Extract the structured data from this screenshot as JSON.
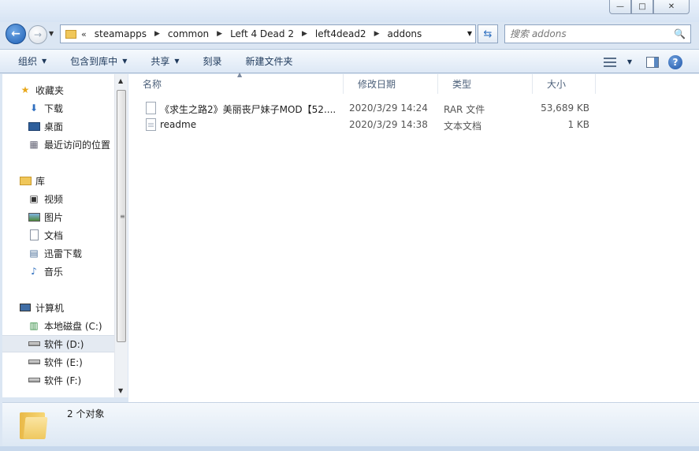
{
  "window": {
    "min_glyph": "—",
    "max_glyph": "□",
    "close_glyph": "✕"
  },
  "nav": {
    "back_glyph": "←",
    "forward_glyph": "→",
    "breadcrumb_overflow": "«",
    "breadcrumbs": [
      "steamapps",
      "common",
      "Left 4 Dead 2",
      "left4dead2",
      "addons"
    ],
    "search_placeholder": "搜索 addons"
  },
  "toolbar": {
    "organize": "组织",
    "include_in_library": "包含到库中",
    "share": "共享",
    "burn": "刻录",
    "new_folder": "新建文件夹",
    "help_glyph": "?"
  },
  "sidebar": {
    "favorites": "收藏夹",
    "downloads": "下载",
    "desktop": "桌面",
    "recent": "最近访问的位置",
    "libraries": "库",
    "videos": "视频",
    "pictures": "图片",
    "documents": "文档",
    "xunlei": "迅雷下载",
    "music": "音乐",
    "computer": "计算机",
    "drive_c": "本地磁盘 (C:)",
    "drive_d": "软件 (D:)",
    "drive_e": "软件 (E:)",
    "drive_f": "软件 (F:)"
  },
  "columns": {
    "name": "名称",
    "date": "修改日期",
    "type": "类型",
    "size": "大小"
  },
  "files": [
    {
      "name": "《求生之路2》美丽丧尸妹子MOD【52....",
      "date": "2020/3/29 14:24",
      "type": "RAR 文件",
      "size": "53,689 KB"
    },
    {
      "name": "readme",
      "date": "2020/3/29 14:38",
      "type": "文本文档",
      "size": "1 KB"
    }
  ],
  "status": {
    "count_text": "2 个对象"
  },
  "colors": {
    "accent": "#1d5fb5",
    "folder": "#f0c75a",
    "selection": "#e4eaf2"
  }
}
